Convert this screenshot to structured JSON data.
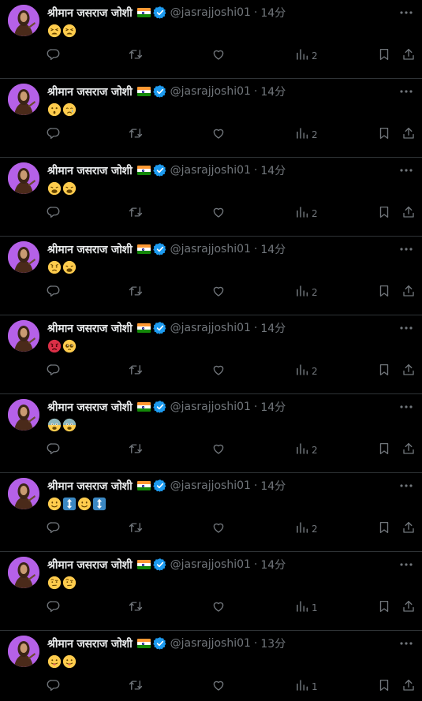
{
  "colors": {
    "background": "#000000",
    "text": "#e7e9ea",
    "muted": "#71767b",
    "divider": "#2f3336",
    "verified": "#1d9bf0",
    "avatar_bg": "#b561e8"
  },
  "icons": {
    "reply": "reply-icon",
    "retweet": "retweet-icon",
    "like": "heart-icon",
    "views": "views-icon",
    "bookmark": "bookmark-icon",
    "share": "share-icon",
    "more": "more-icon",
    "verified": "verified-badge-icon"
  },
  "tweets": [
    {
      "name": "श्रीमान जसराज जोशी",
      "handle": "@jasrajjoshi01",
      "separator": "·",
      "time": "14分",
      "emojis": [
        "tired",
        "tired"
      ],
      "views": "2"
    },
    {
      "name": "श्रीमान जसराज जोशी",
      "handle": "@jasrajjoshi01",
      "separator": "·",
      "time": "14分",
      "emojis": [
        "hushed",
        "crying"
      ],
      "views": "2"
    },
    {
      "name": "श्रीमान जसराज जोशी",
      "handle": "@jasrajjoshi01",
      "separator": "·",
      "time": "14分",
      "emojis": [
        "weary",
        "weary"
      ],
      "views": "2"
    },
    {
      "name": "श्रीमान जसराज जोशी",
      "handle": "@jasrajjoshi01",
      "separator": "·",
      "time": "14分",
      "emojis": [
        "angry",
        "weary"
      ],
      "views": "2"
    },
    {
      "name": "श्रीमान जसराज जोशी",
      "handle": "@jasrajjoshi01",
      "separator": "·",
      "time": "14分",
      "emojis": [
        "rage",
        "pleading"
      ],
      "views": "2"
    },
    {
      "name": "श्रीमान जसराज जोशी",
      "handle": "@jasrajjoshi01",
      "separator": "·",
      "time": "14分",
      "emojis": [
        "fearful",
        "fearful"
      ],
      "views": "2"
    },
    {
      "name": "श्रीमान जसराज जोशी",
      "handle": "@jasrajjoshi01",
      "separator": "·",
      "time": "14分",
      "emojis": [
        "smile",
        "updown",
        "smile",
        "updown"
      ],
      "views": "2"
    },
    {
      "name": "श्रीमान जसराज जोशी",
      "handle": "@jasrajjoshi01",
      "separator": "·",
      "time": "14分",
      "emojis": [
        "raised-eyebrow",
        "raised-eyebrow"
      ],
      "views": "1"
    },
    {
      "name": "श्रीमान जसराज जोशी",
      "handle": "@jasrajjoshi01",
      "separator": "·",
      "time": "13分",
      "emojis": [
        "tongue",
        "tongue"
      ],
      "views": "1"
    }
  ]
}
